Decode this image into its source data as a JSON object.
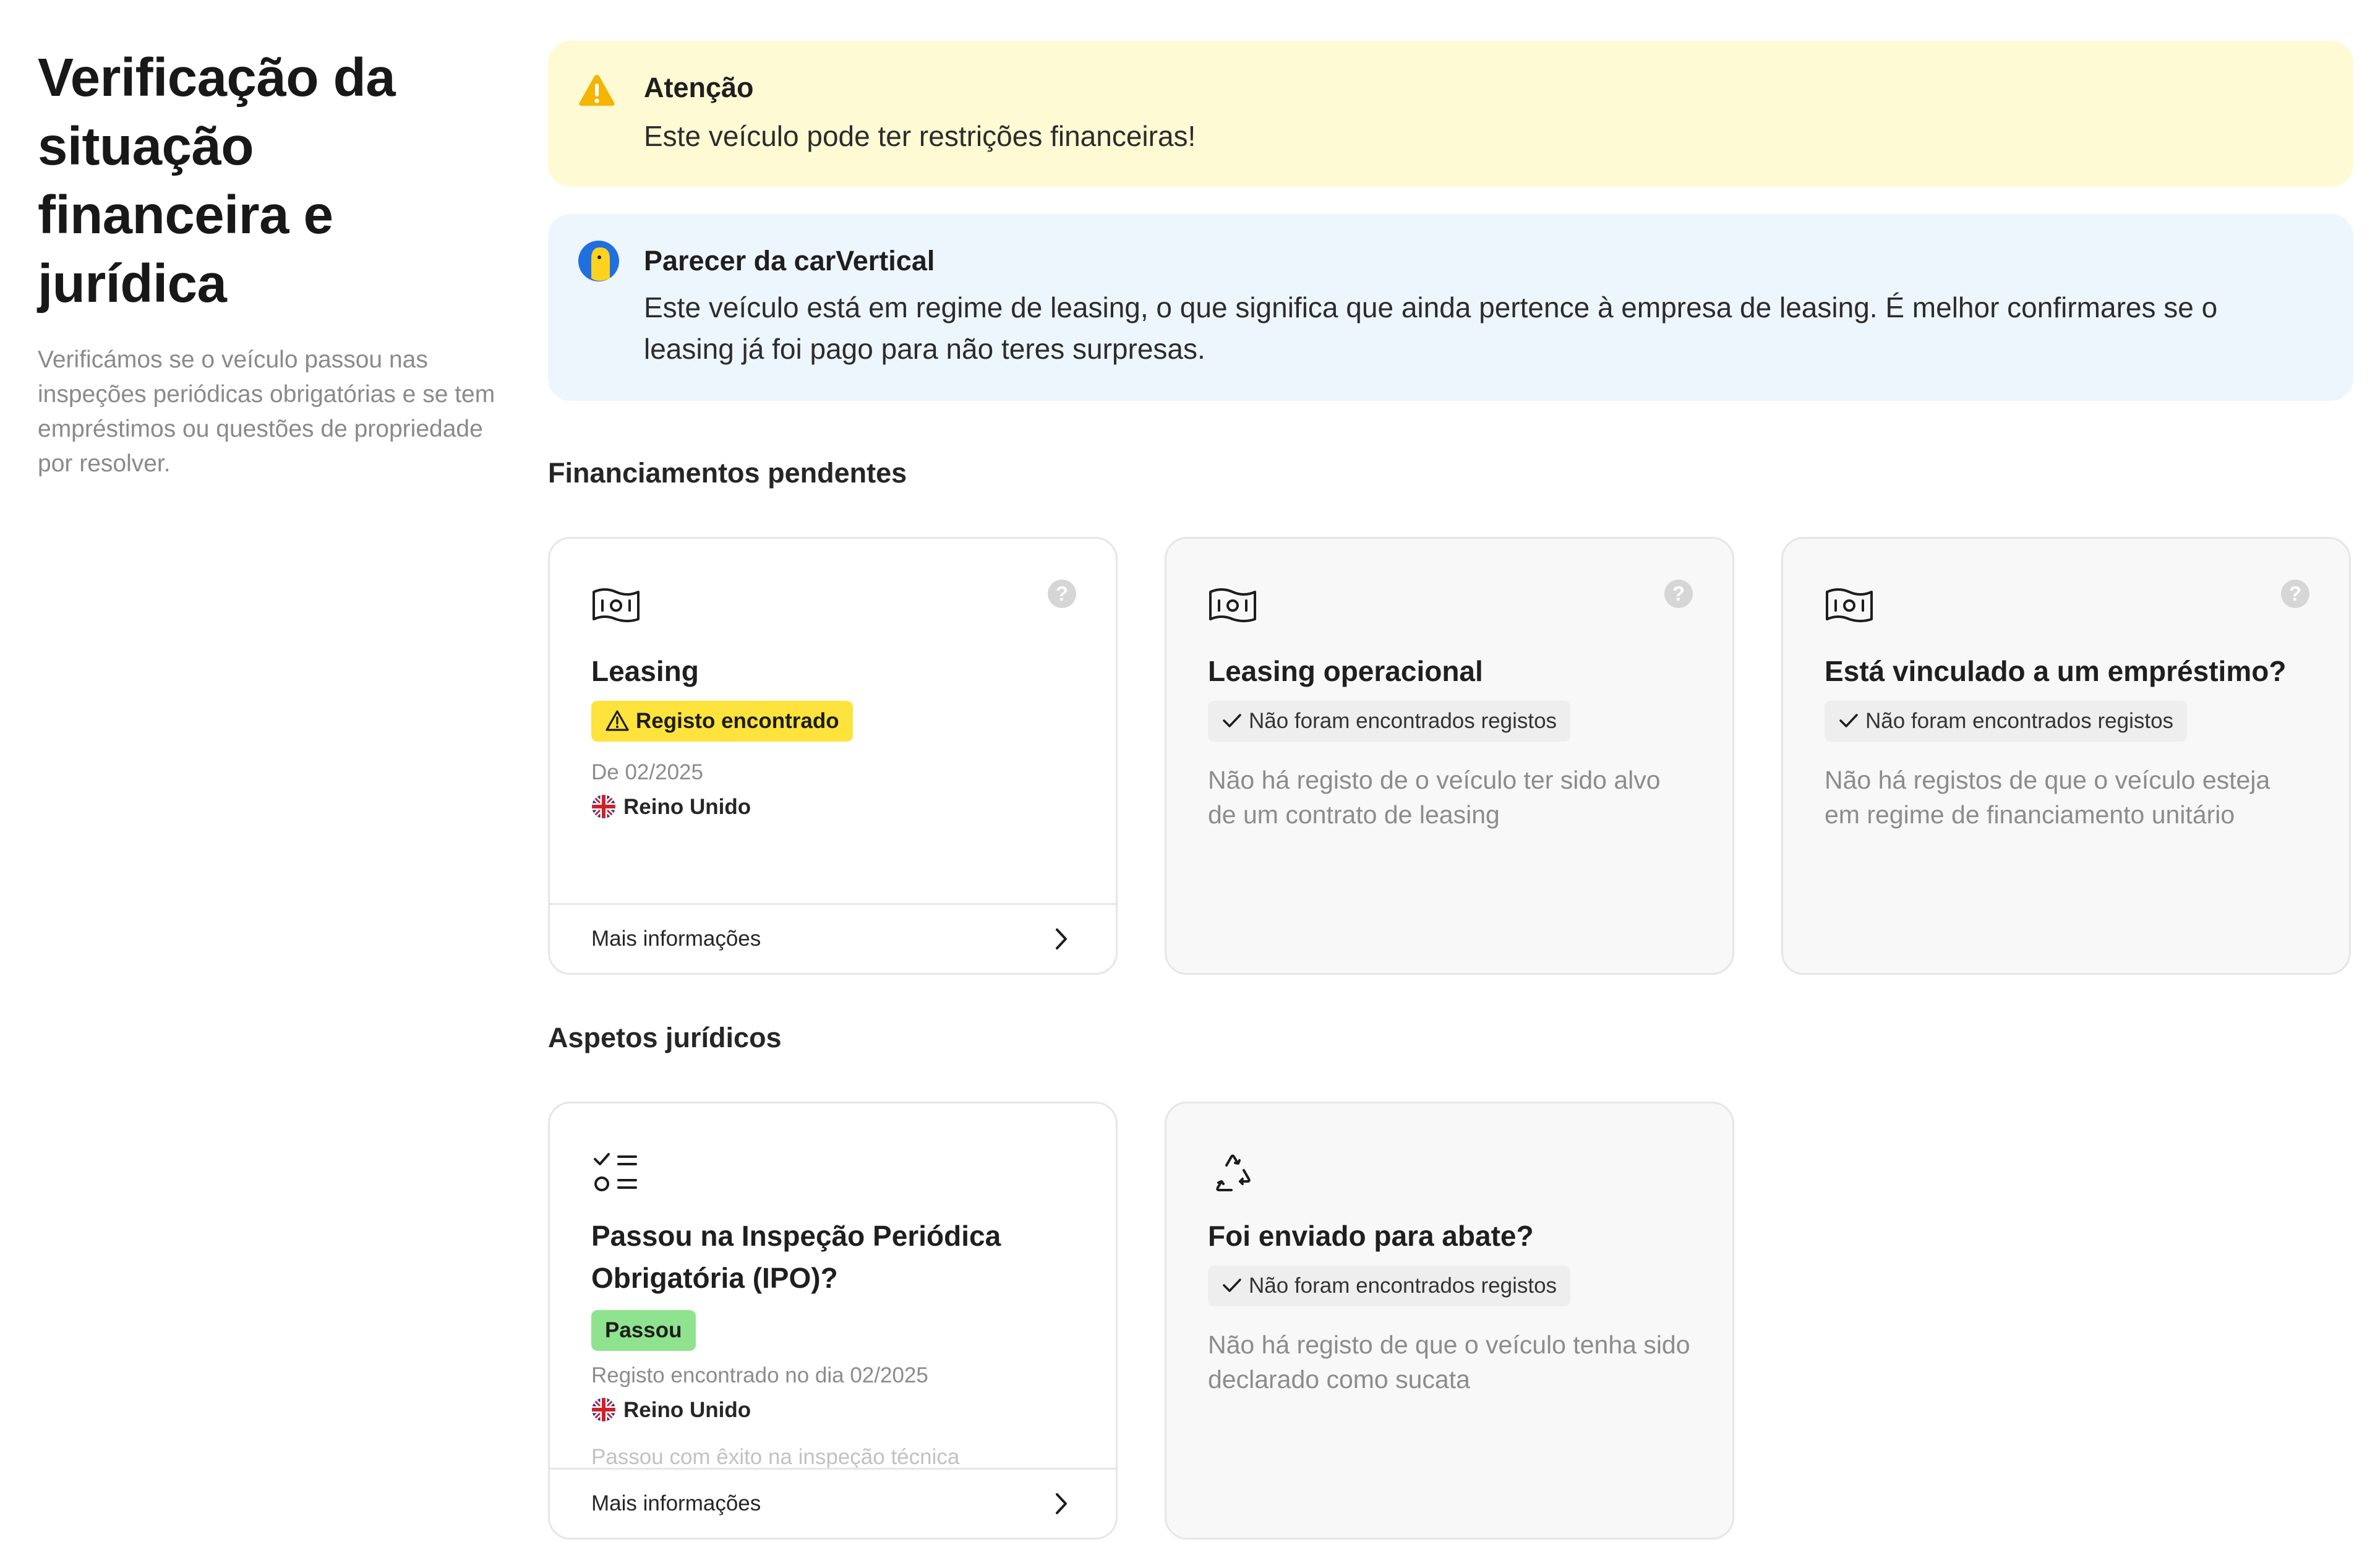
{
  "sidebar": {
    "title": "Verificação da situação financeira e jurídica",
    "description": "Verificámos se o veículo passou nas inspeções periódicas obrigatórias e se tem empréstimos ou questões de propriedade por resolver."
  },
  "alerts": {
    "warning": {
      "icon": "warning-icon",
      "title": "Atenção",
      "body": "Este veículo pode ter restrições financeiras!"
    },
    "info": {
      "icon": "carvertical-logo",
      "title": "Parecer da carVertical",
      "body": "Este veículo está em regime de leasing, o que significa que ainda pertence à empresa de leasing. É melhor confirmares se o leasing já foi pago para não teres surpresas."
    }
  },
  "sections": {
    "financing": {
      "title": "Financiamentos pendentes",
      "cards": [
        {
          "icon": "banknote-icon",
          "title": "Leasing",
          "badge": "Registo encontrado",
          "date": "De 02/2025",
          "country": "Reino Unido",
          "footer": "Mais informações"
        },
        {
          "icon": "banknote-icon",
          "title": "Leasing operacional",
          "badge": "Não foram encontrados registos",
          "description": "Não há registo de o veículo ter sido alvo de um contrato de leasing"
        },
        {
          "icon": "banknote-icon",
          "title": "Está vinculado a um empréstimo?",
          "badge": "Não foram encontrados registos",
          "description": "Não há registos de que o veículo esteja em regime de financiamento unitário"
        }
      ]
    },
    "legal": {
      "title": "Aspetos jurídicos",
      "cards": [
        {
          "icon": "checklist-icon",
          "title": "Passou na Inspeção Periódica Obrigatória (IPO)?",
          "badge": "Passou",
          "date": "Registo encontrado no dia 02/2025",
          "country": "Reino Unido",
          "faded": "Passou com êxito na inspeção técnica",
          "footer": "Mais informações"
        },
        {
          "icon": "recycle-icon",
          "title": "Foi enviado para abate?",
          "badge": "Não foram encontrados registos",
          "description": "Não há registo de que o veículo tenha sido declarado como sucata"
        }
      ]
    }
  },
  "help_icon": "?",
  "colors": {
    "warning_bg": "#fefad3",
    "info_bg": "#eef6fd",
    "badge_warning": "#fde33c",
    "badge_pass": "#8fe38e",
    "badge_neutral": "#eeeeee"
  }
}
